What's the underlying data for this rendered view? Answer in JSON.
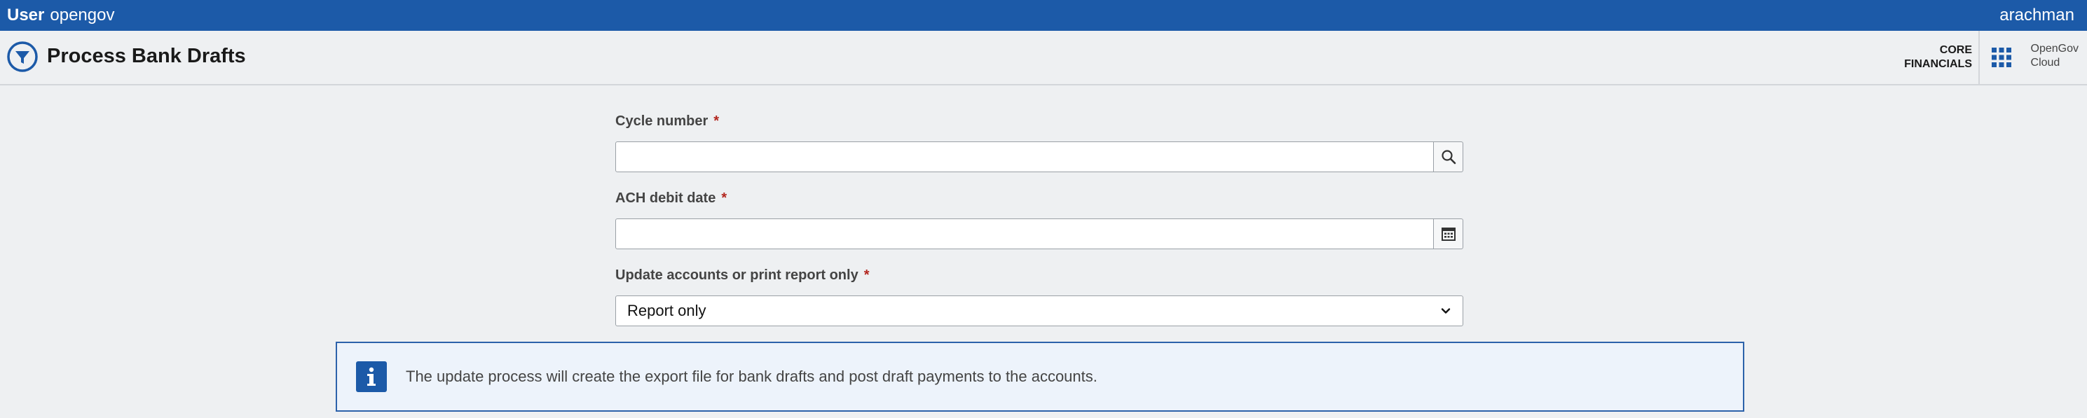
{
  "topbar": {
    "label": "User",
    "user": "opengov",
    "right_user": "arachman"
  },
  "header": {
    "title": "Process Bank Drafts",
    "product_line1": "CORE",
    "product_line2": "FINANCIALS",
    "cloud_line1": "OpenGov",
    "cloud_line2": "Cloud",
    "title_icon": "funnel-circle-icon",
    "apps_icon": "app-grid-icon"
  },
  "form": {
    "cycle": {
      "label": "Cycle number",
      "required": "*",
      "value": "",
      "icon": "search-icon"
    },
    "ach": {
      "label": "ACH debit date",
      "required": "*",
      "value": "",
      "icon": "calendar-icon"
    },
    "update": {
      "label": "Update accounts or print report only",
      "required": "*",
      "selected": "Report only",
      "icon": "chevron-down-icon"
    }
  },
  "info": {
    "icon": "info-icon",
    "text": "The update process will create the export file for bank drafts and post draft payments to the accounts."
  },
  "colors": {
    "brand_blue": "#1c5aa8",
    "required_red": "#b3261e",
    "background": "#eef0f2"
  }
}
